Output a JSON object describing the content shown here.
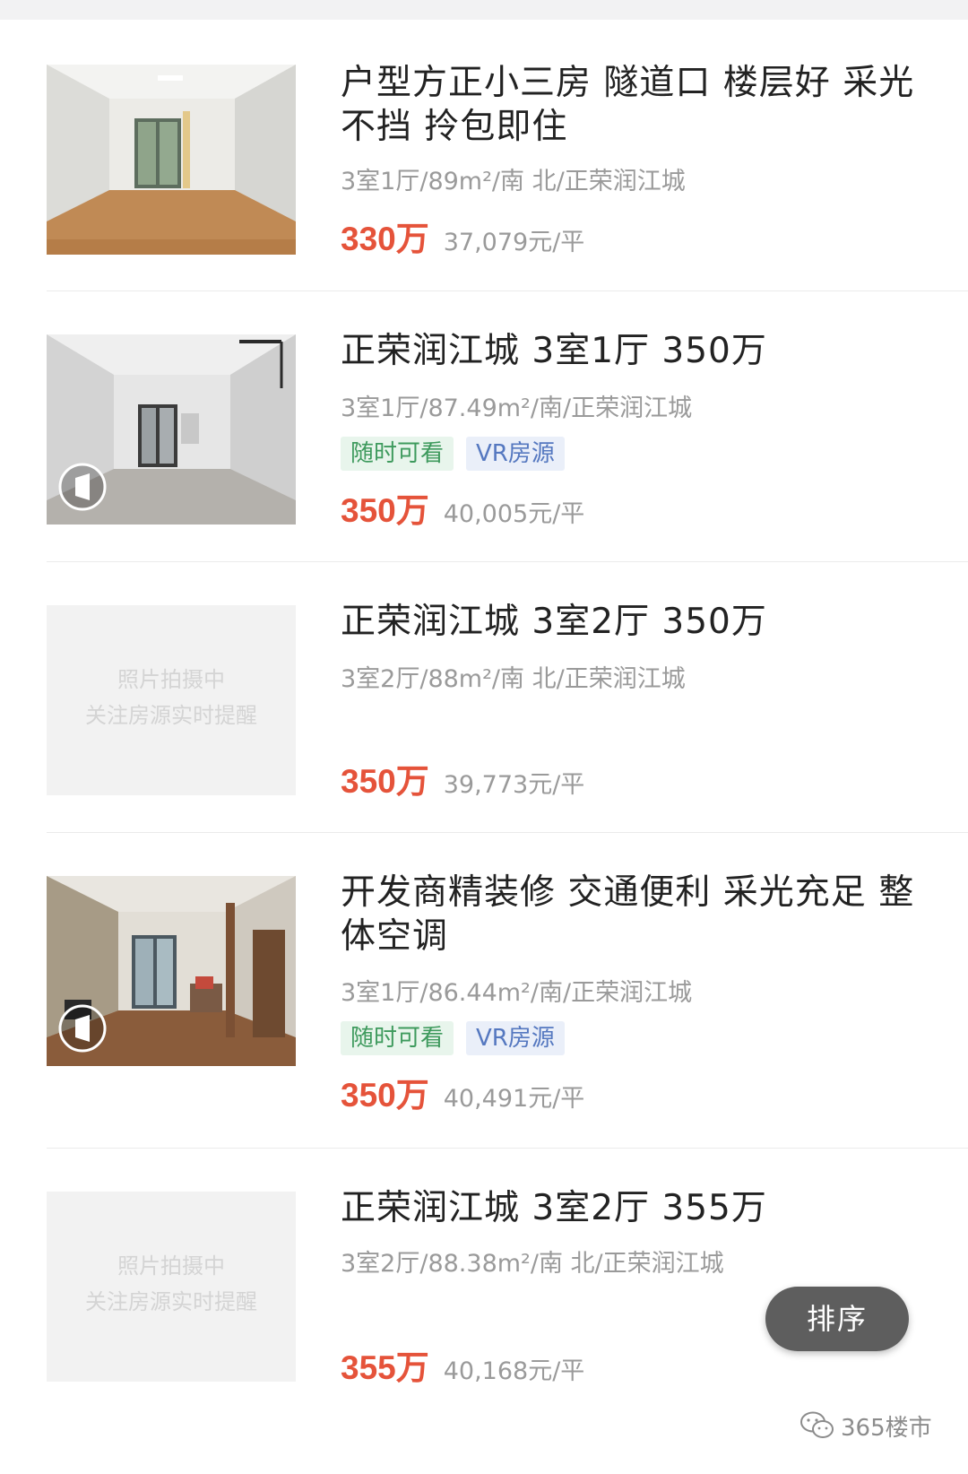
{
  "listings": [
    {
      "title": "户型方正小三房 隧道口 楼层好 采光不挡 拎包即住",
      "meta": "3室1厅/89m²/南 北/正荣润江城",
      "price": "330万",
      "unit_price": "37,079元/平",
      "photo": "photo",
      "vr": false,
      "tags": []
    },
    {
      "title": "正荣润江城 3室1厅 350万",
      "meta": "3室1厅/87.49m²/南/正荣润江城",
      "price": "350万",
      "unit_price": "40,005元/平",
      "photo": "photo",
      "vr": true,
      "tags": [
        "随时可看",
        "VR房源"
      ]
    },
    {
      "title": "正荣润江城 3室2厅 350万",
      "meta": "3室2厅/88m²/南 北/正荣润江城",
      "price": "350万",
      "unit_price": "39,773元/平",
      "photo": "placeholder",
      "placeholder_lines": [
        "照片拍摄中",
        "关注房源实时提醒"
      ],
      "vr": false,
      "tags": []
    },
    {
      "title": "开发商精装修 交通便利 采光充足 整体空调",
      "meta": "3室1厅/86.44m²/南/正荣润江城",
      "price": "350万",
      "unit_price": "40,491元/平",
      "photo": "photo",
      "vr": true,
      "tags": [
        "随时可看",
        "VR房源"
      ]
    },
    {
      "title": "正荣润江城 3室2厅 355万",
      "meta": "3室2厅/88.38m²/南 北/正荣润江城",
      "price": "355万",
      "unit_price": "40,168元/平",
      "photo": "placeholder",
      "placeholder_lines": [
        "照片拍摄中",
        "关注房源实时提醒"
      ],
      "vr": false,
      "tags": []
    }
  ],
  "sort_button": {
    "label": "排序"
  },
  "watermark": {
    "text": "365楼市",
    "icon": "wechat-icon"
  },
  "colors": {
    "price": "#e5533a",
    "tag_green_text": "#3e9a5d",
    "tag_green_bg": "#e8f5ec",
    "tag_blue_text": "#5578c0",
    "tag_blue_bg": "#eaeff9"
  }
}
